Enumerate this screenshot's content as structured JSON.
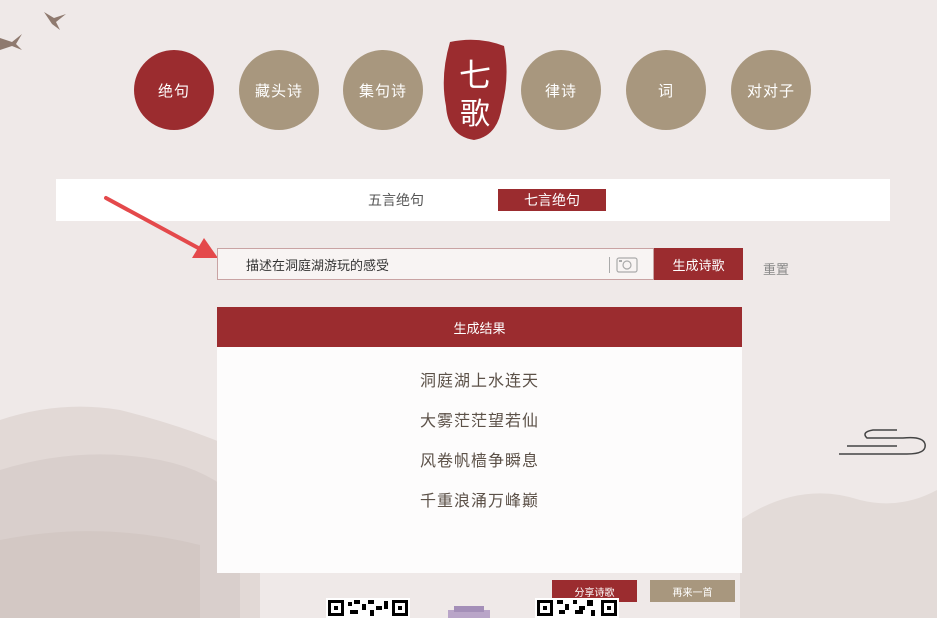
{
  "nav": {
    "items": [
      {
        "label": "绝句",
        "active": true
      },
      {
        "label": "藏头诗",
        "active": false
      },
      {
        "label": "集句诗",
        "active": false
      },
      {
        "label": "律诗",
        "active": false
      },
      {
        "label": "词",
        "active": false
      },
      {
        "label": "对对子",
        "active": false
      }
    ],
    "logo_text": "七歌"
  },
  "tabs": [
    {
      "label": "五言绝句",
      "active": false
    },
    {
      "label": "七言绝句",
      "active": true
    }
  ],
  "search": {
    "value": "描述在洞庭湖游玩的感受",
    "camera_icon": "camera-icon"
  },
  "actions": {
    "generate": "生成诗歌",
    "reset": "重置",
    "share": "分享诗歌",
    "again": "再来一首"
  },
  "result": {
    "header": "生成结果",
    "lines": [
      "洞庭湖上水连天",
      "大雾茫茫望若仙",
      "风卷帆樯争瞬息",
      "千重浪涌万峰巅"
    ]
  },
  "colors": {
    "accent": "#9b2c2f",
    "secondary": "#a8977e",
    "background": "#efe9e8"
  }
}
